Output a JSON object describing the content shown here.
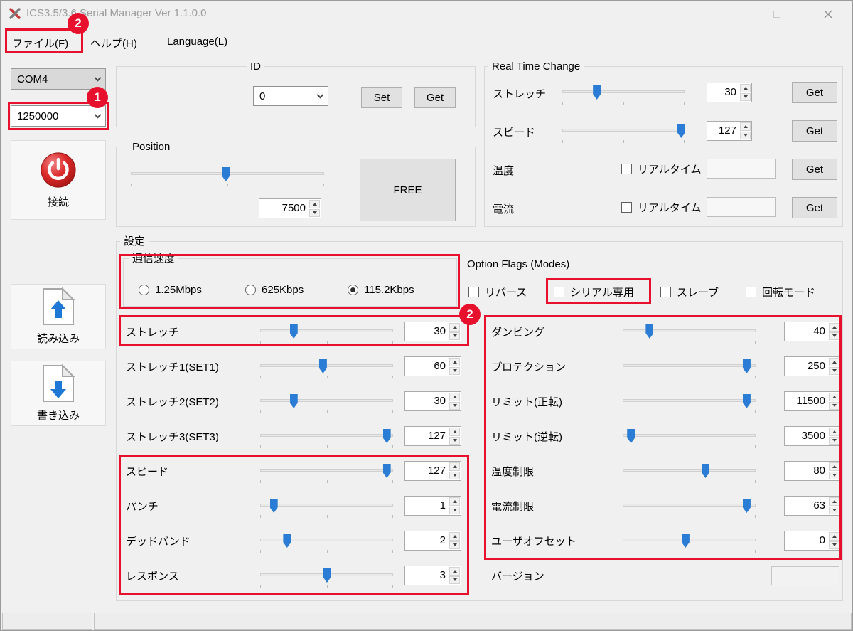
{
  "window": {
    "title": "ICS3.5/3.6 Serial Manager  Ver 1.1.0.0"
  },
  "menu": {
    "file": "ファイル(F)",
    "help": "ヘルプ(H)",
    "language": "Language(L)"
  },
  "connection": {
    "com_port": "COM4",
    "baud_rate": "1250000",
    "connect": "接続",
    "read": "読み込み",
    "write": "書き込み"
  },
  "id_group": {
    "title": "ID",
    "selected_id": "0",
    "set": "Set",
    "get": "Get"
  },
  "position_group": {
    "title": "Position",
    "value": "7500",
    "slider_pos": 0.49,
    "free": "FREE"
  },
  "realtime_group": {
    "title": "Real Time Change",
    "get": "Get",
    "stretch": {
      "label": "ストレッチ",
      "value": "30",
      "slider_pos": 0.28
    },
    "speed": {
      "label": "スピード",
      "value": "127",
      "slider_pos": 0.97
    },
    "temperature": {
      "label": "温度",
      "checkbox": "リアルタイム",
      "checked": false,
      "value": ""
    },
    "current": {
      "label": "電流",
      "checkbox": "リアルタイム",
      "checked": false,
      "value": ""
    }
  },
  "settings": {
    "title": "設定",
    "comm_speed": {
      "title": "通信速度",
      "options": [
        {
          "label": "1.25Mbps",
          "selected": false
        },
        {
          "label": "625Kbps",
          "selected": false
        },
        {
          "label": "115.2Kbps",
          "selected": true
        }
      ]
    },
    "option_flags": {
      "title": "Option Flags (Modes)",
      "options": [
        {
          "label": "リバース",
          "checked": false
        },
        {
          "label": "シリアル専用",
          "checked": false
        },
        {
          "label": "スレーブ",
          "checked": false
        },
        {
          "label": "回転モード",
          "checked": false
        }
      ]
    },
    "left_params": [
      {
        "label": "ストレッチ",
        "value": "30",
        "slider_pos": 0.25
      },
      {
        "label": "ストレッチ1(SET1)",
        "value": "60",
        "slider_pos": 0.47
      },
      {
        "label": "ストレッチ2(SET2)",
        "value": "30",
        "slider_pos": 0.25
      },
      {
        "label": "ストレッチ3(SET3)",
        "value": "127",
        "slider_pos": 0.95
      },
      {
        "label": "スピード",
        "value": "127",
        "slider_pos": 0.95
      },
      {
        "label": "パンチ",
        "value": "1",
        "slider_pos": 0.1
      },
      {
        "label": "デッドバンド",
        "value": "2",
        "slider_pos": 0.2
      },
      {
        "label": "レスポンス",
        "value": "3",
        "slider_pos": 0.5
      }
    ],
    "right_params": [
      {
        "label": "ダンピング",
        "value": "40",
        "slider_pos": 0.2
      },
      {
        "label": "プロテクション",
        "value": "250",
        "slider_pos": 0.93
      },
      {
        "label": "リミット(正転)",
        "value": "11500",
        "slider_pos": 0.93
      },
      {
        "label": "リミット(逆転)",
        "value": "3500",
        "slider_pos": 0.06
      },
      {
        "label": "温度制限",
        "value": "80",
        "slider_pos": 0.62
      },
      {
        "label": "電流制限",
        "value": "63",
        "slider_pos": 0.93
      },
      {
        "label": "ユーザオフセット",
        "value": "0",
        "slider_pos": 0.47
      }
    ],
    "version": {
      "label": "バージョン",
      "value": ""
    }
  },
  "annotations": {
    "color": "#e8112d",
    "badge_menu": "2",
    "badge_baud": "1",
    "badge_settings": "2"
  }
}
